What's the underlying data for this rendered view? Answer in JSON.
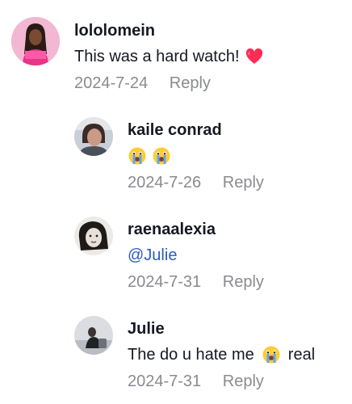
{
  "comments": [
    {
      "username": "lololomein",
      "text": "This was a hard watch!",
      "emoji": "heart-icon",
      "date": "2024-7-24",
      "reply": "Reply"
    },
    {
      "username": "kaile conrad",
      "emojis": [
        "crying-face-icon",
        "crying-face-icon"
      ],
      "date": "2024-7-26",
      "reply": "Reply"
    },
    {
      "username": "raenaalexia",
      "mention": "@Julie",
      "date": "2024-7-31",
      "reply": "Reply"
    },
    {
      "username": "Julie",
      "text_before": "The do u hate me",
      "emoji": "crying-face-icon",
      "text_after": "real",
      "date": "2024-7-31",
      "reply": "Reply"
    }
  ],
  "colors": {
    "username": "#161823",
    "meta": "#8a8b91",
    "mention": "#2b5db9",
    "heart": "#fe2c55"
  }
}
